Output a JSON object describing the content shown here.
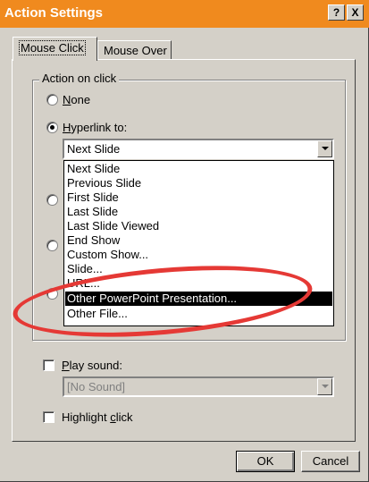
{
  "window": {
    "title": "Action Settings",
    "help_button": "?",
    "close_button": "X"
  },
  "tabs": [
    {
      "label": "Mouse Click",
      "active": true
    },
    {
      "label": "Mouse Over",
      "active": false
    }
  ],
  "action_group": {
    "label": "Action on click",
    "options": {
      "none": {
        "label": "None",
        "mnemonic_char": "N",
        "rest": "one",
        "selected": false
      },
      "hyperlink": {
        "label": "Hyperlink to:",
        "mnemonic_char": "H",
        "rest": "yperlink to:",
        "selected": true
      }
    },
    "hyperlink_combo_value": "Next Slide",
    "dropdown_items": [
      "Next Slide",
      "Previous Slide",
      "First Slide",
      "Last Slide",
      "Last Slide Viewed",
      "End Show",
      "Custom Show...",
      "Slide...",
      "URL...",
      "Other PowerPoint Presentation...",
      "Other File..."
    ],
    "dropdown_selected_index": 9
  },
  "play_sound": {
    "label": "Play sound:",
    "mnemonic_char": "P",
    "rest": "lay sound:",
    "checked": false,
    "combo_value": "[No Sound]"
  },
  "highlight_click": {
    "label_prefix": "Highlight ",
    "mnemonic_char": "c",
    "rest": "lick",
    "checked": false
  },
  "buttons": {
    "ok": "OK",
    "cancel": "Cancel"
  },
  "colors": {
    "titlebar": "#f08a1e",
    "annotation": "#e53935",
    "face": "#d4d0c8"
  }
}
